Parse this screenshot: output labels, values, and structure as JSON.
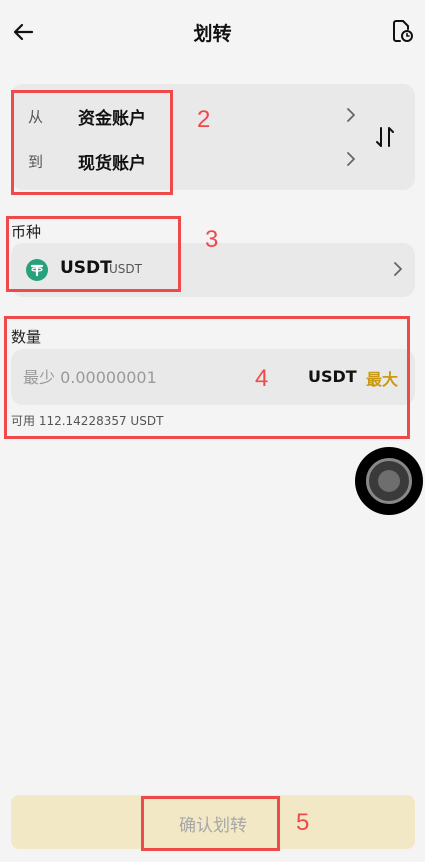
{
  "header": {
    "title": "划转",
    "back_icon": "arrow-left-icon",
    "history_icon": "history-icon"
  },
  "transfer": {
    "from_label": "从",
    "from_account": "资金账户",
    "to_label": "到",
    "to_account": "现货账户",
    "swap_icon": "swap-vertical-icon"
  },
  "coin": {
    "section_label": "币种",
    "symbol": "USDT",
    "name": "USDT",
    "icon": "tether-coin-icon"
  },
  "amount": {
    "section_label": "数量",
    "placeholder": "最少 0.00000001",
    "unit": "USDT",
    "max_label": "最大",
    "available_text": "可用 112.14228357 USDT"
  },
  "confirm": {
    "label": "确认划转"
  },
  "annotations": [
    "2",
    "3",
    "4",
    "5"
  ],
  "colors": {
    "accent": "#c89a16",
    "annotation": "#ef4a4a",
    "tether": "#26a17b",
    "confirm_bg": "#f2e8c5"
  }
}
